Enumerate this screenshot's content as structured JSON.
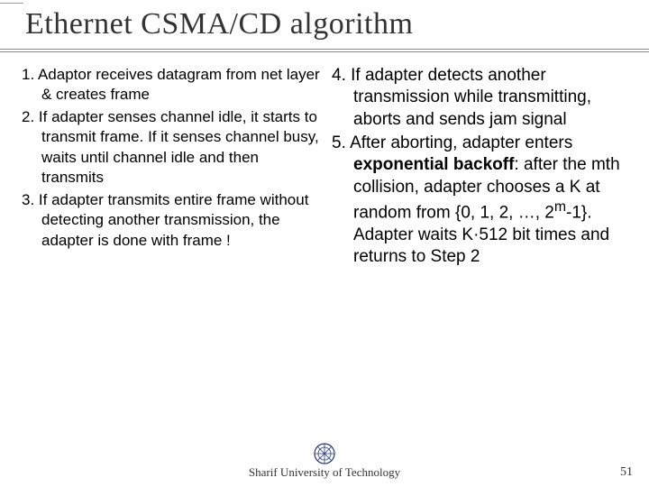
{
  "title": "Ethernet CSMA/CD algorithm",
  "left": {
    "i1": "1. Adaptor receives datagram from net layer & creates frame",
    "i2": "2. If adapter senses channel idle, it starts to transmit frame. If it senses channel busy, waits until channel idle and then transmits",
    "i3": "3. If adapter transmits entire frame without detecting another transmission, the adapter is done with frame !"
  },
  "right": {
    "i4": "4. If adapter detects another transmission while transmitting,  aborts and sends jam signal",
    "i5a": "5. After aborting, adapter enters ",
    "i5bold": "exponential backoff",
    "i5b": ": after the mth collision, adapter chooses a K at random from {0, 1, 2, …, 2",
    "i5sup": "m",
    "i5c": "-1}. Adapter waits K·512 bit times and returns to Step 2"
  },
  "footer": "Sharif University of Technology",
  "page": "51"
}
